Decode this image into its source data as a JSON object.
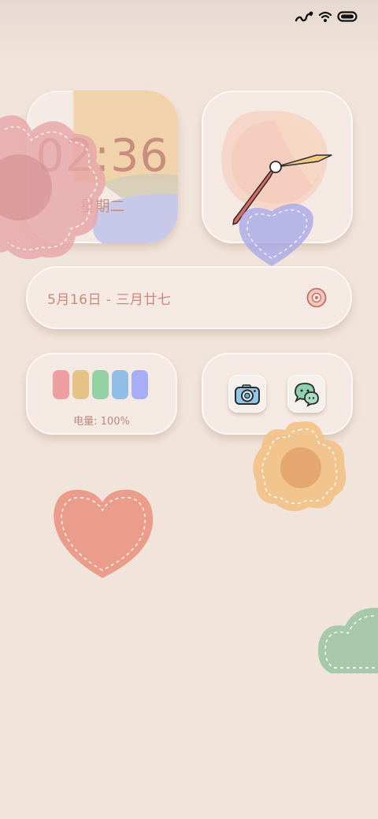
{
  "status_bar": {
    "icons": [
      "signal-icon",
      "wifi-icon",
      "battery-icon"
    ]
  },
  "clock_widget": {
    "time": "02:36",
    "weekday": "星期二"
  },
  "analog_clock_widget": {
    "time_shown": "02:36"
  },
  "date_widget": {
    "text": "5月16日 - 三月廿七",
    "icon": "cd-icon"
  },
  "battery_widget": {
    "bar_colors": [
      "#ee9f9f",
      "#e6c287",
      "#93d0a3",
      "#8fbde6",
      "#a7aef5"
    ],
    "label": "电量: 100%",
    "level": 1.0
  },
  "apps_widget": {
    "apps": [
      {
        "name": "camera",
        "icon": "camera-icon"
      },
      {
        "name": "chat",
        "icon": "chat-icon"
      }
    ]
  },
  "colors": {
    "background": "#f1e4da",
    "accent_text": "#c98d80",
    "heart_red": "#eb9c8a",
    "flower_orange": "#f3c185",
    "heart_green": "#a7c9aa"
  }
}
